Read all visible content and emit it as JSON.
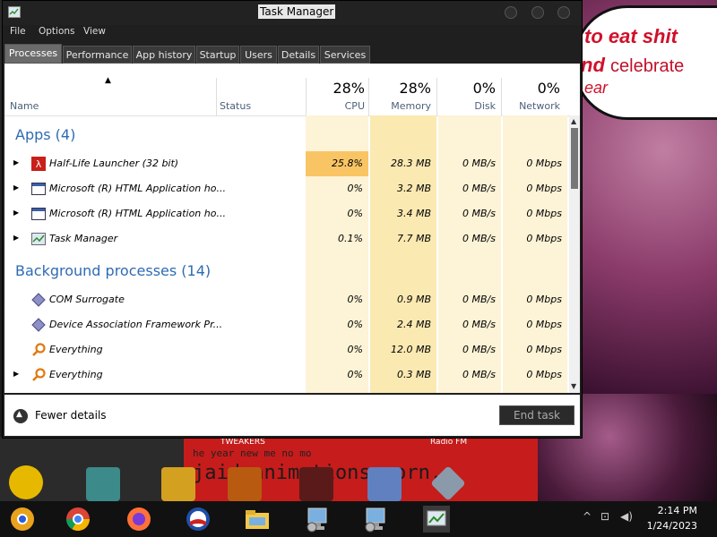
{
  "window": {
    "title": "Task Manager"
  },
  "menu": [
    "File",
    "Options",
    "View"
  ],
  "tabs": [
    {
      "label": "Processes",
      "active": true
    },
    {
      "label": "Performance"
    },
    {
      "label": "App history"
    },
    {
      "label": "Startup"
    },
    {
      "label": "Users"
    },
    {
      "label": "Details"
    },
    {
      "label": "Services"
    }
  ],
  "columns": {
    "name": "Name",
    "status": "Status",
    "cpu": {
      "pct": "28%",
      "label": "CPU"
    },
    "memory": {
      "pct": "28%",
      "label": "Memory"
    },
    "disk": {
      "pct": "0%",
      "label": "Disk"
    },
    "network": {
      "pct": "0%",
      "label": "Network"
    }
  },
  "groups": {
    "apps": "Apps (4)",
    "background": "Background processes (14)"
  },
  "apps": [
    {
      "name": "Half-Life Launcher (32 bit)",
      "cpu": "25.8%",
      "memory": "28.3 MB",
      "disk": "0 MB/s",
      "network": "0 Mbps",
      "icon": "half-life-icon"
    },
    {
      "name": "Microsoft (R) HTML Application ho...",
      "cpu": "0%",
      "memory": "3.2 MB",
      "disk": "0 MB/s",
      "network": "0 Mbps",
      "icon": "window-app-icon"
    },
    {
      "name": "Microsoft (R) HTML Application ho...",
      "cpu": "0%",
      "memory": "3.4 MB",
      "disk": "0 MB/s",
      "network": "0 Mbps",
      "icon": "window-app-icon"
    },
    {
      "name": "Task Manager",
      "cpu": "0.1%",
      "memory": "7.7 MB",
      "disk": "0 MB/s",
      "network": "0 Mbps",
      "icon": "task-manager-icon"
    }
  ],
  "background": [
    {
      "name": "COM Surrogate",
      "cpu": "0%",
      "memory": "0.9 MB",
      "disk": "0 MB/s",
      "network": "0 Mbps",
      "icon": "com-surrogate-icon",
      "expandable": false
    },
    {
      "name": "Device Association Framework Pr...",
      "cpu": "0%",
      "memory": "2.4 MB",
      "disk": "0 MB/s",
      "network": "0 Mbps",
      "icon": "device-association-icon",
      "expandable": false
    },
    {
      "name": "Everything",
      "cpu": "0%",
      "memory": "12.0 MB",
      "disk": "0 MB/s",
      "network": "0 Mbps",
      "icon": "everything-search-icon",
      "expandable": false
    },
    {
      "name": "Everything",
      "cpu": "0%",
      "memory": "0.3 MB",
      "disk": "0 MB/s",
      "network": "0 Mbps",
      "icon": "everything-search-icon",
      "expandable": true
    }
  ],
  "footer": {
    "fewer_details": "Fewer details",
    "end_task": "End task"
  },
  "wallpaper": {
    "line1": "to eat shit",
    "line2_a": "nd",
    "line2_b": "celebrate",
    "line3": "ear",
    "tweakers": "TWEAKERS",
    "radio": "Radio FM",
    "bottom_line1": "he year new me no mo",
    "bottom_line2": "jaid animations porn."
  },
  "taskbar": {
    "time": "2:14 PM",
    "date": "1/24/2023",
    "icons": [
      "chrome-canary-icon",
      "chrome-icon",
      "firefox-icon",
      "obama-logo-icon",
      "file-explorer-icon",
      "hta-app-icon",
      "hta-app-icon",
      "task-manager-icon"
    ]
  },
  "colors": {
    "group_text": "#2e6bb3",
    "cpu_high": "#f9c564",
    "cell_light": "#fdf3d6",
    "cell_mid": "#fbe9b2"
  }
}
